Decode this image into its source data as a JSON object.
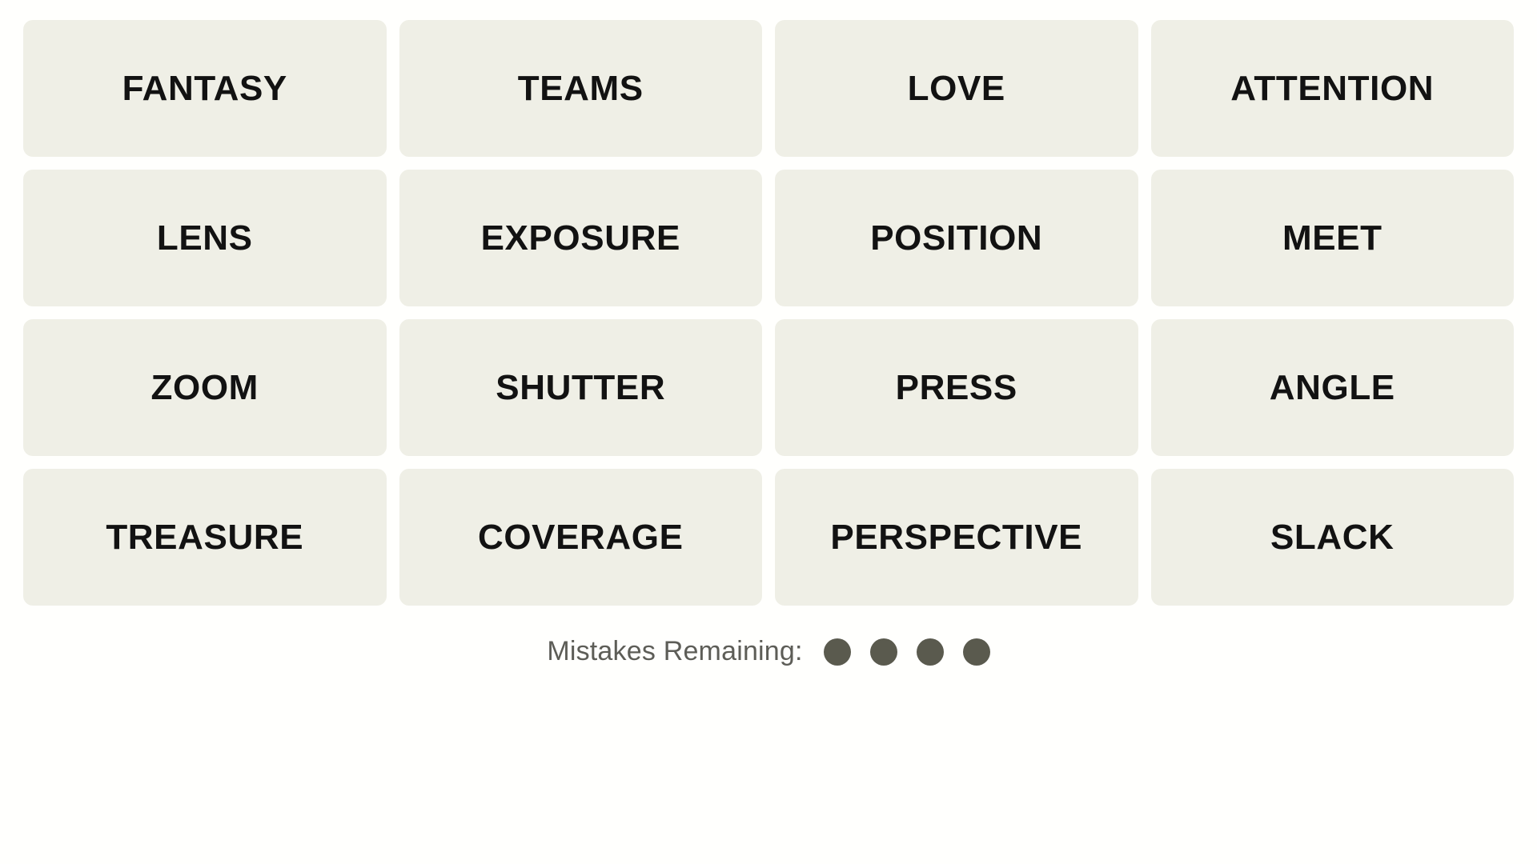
{
  "game": {
    "name": "Connections",
    "grid_rows": 4,
    "grid_cols": 4
  },
  "colors": {
    "page_background": "#fffffd",
    "tile_background": "#efefe6",
    "tile_text": "#121212",
    "footer_text": "#5d5d57",
    "mistake_dot": "#5a5a4e"
  },
  "tiles": [
    {
      "label": "FANTASY",
      "row": 1,
      "col": 1
    },
    {
      "label": "TEAMS",
      "row": 1,
      "col": 2
    },
    {
      "label": "LOVE",
      "row": 1,
      "col": 3
    },
    {
      "label": "ATTENTION",
      "row": 1,
      "col": 4
    },
    {
      "label": "LENS",
      "row": 2,
      "col": 1
    },
    {
      "label": "EXPOSURE",
      "row": 2,
      "col": 2
    },
    {
      "label": "POSITION",
      "row": 2,
      "col": 3
    },
    {
      "label": "MEET",
      "row": 2,
      "col": 4
    },
    {
      "label": "ZOOM",
      "row": 3,
      "col": 1
    },
    {
      "label": "SHUTTER",
      "row": 3,
      "col": 2
    },
    {
      "label": "PRESS",
      "row": 3,
      "col": 3
    },
    {
      "label": "ANGLE",
      "row": 3,
      "col": 4
    },
    {
      "label": "TREASURE",
      "row": 4,
      "col": 1
    },
    {
      "label": "COVERAGE",
      "row": 4,
      "col": 2
    },
    {
      "label": "PERSPECTIVE",
      "row": 4,
      "col": 3
    },
    {
      "label": "SLACK",
      "row": 4,
      "col": 4
    }
  ],
  "footer": {
    "mistakes_label": "Mistakes Remaining:",
    "mistakes_remaining": 4
  }
}
